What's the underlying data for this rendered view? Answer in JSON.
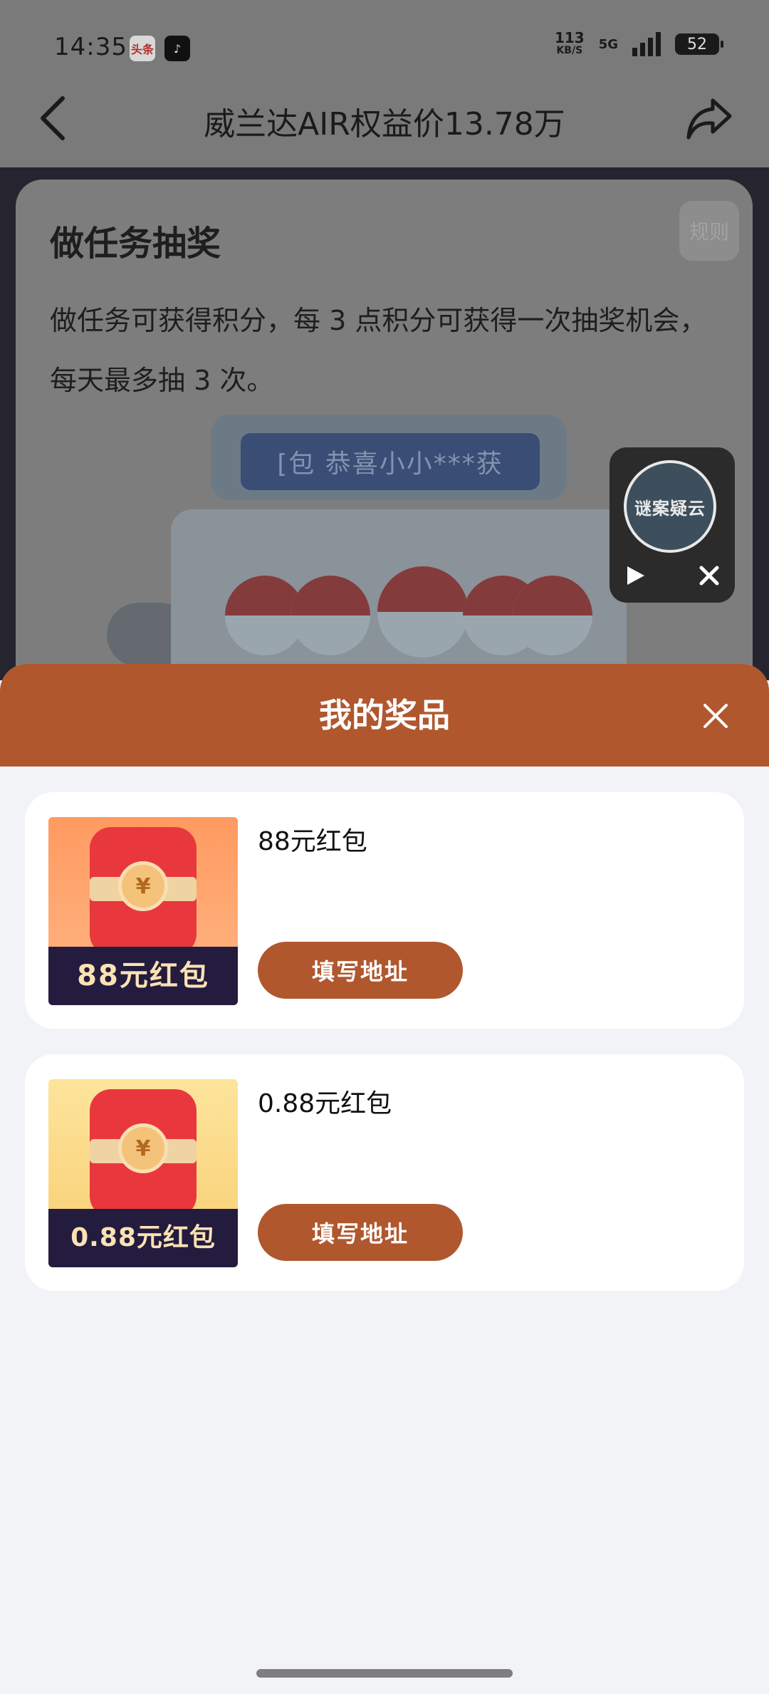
{
  "status_bar": {
    "time": "14:35",
    "apps": [
      {
        "name": "toutiao",
        "glyph": "头条"
      },
      {
        "name": "tiktok",
        "glyph": "♪"
      }
    ],
    "net_speed_value": "113",
    "net_speed_unit": "KB/S",
    "network": "5G",
    "battery": "52"
  },
  "header": {
    "title": "威兰达AIR权益价13.78万",
    "back_icon": "chevron-left-icon",
    "share_icon": "share-icon"
  },
  "task": {
    "title": "做任务抽奖",
    "rules_label": "规则",
    "description": "做任务可获得积分，每 3 点积分可获得一次抽奖机会，每天最多抽 3 次。",
    "marquee": "[包  恭喜小小***获"
  },
  "mini_player": {
    "cover_text": "谜案疑云",
    "play_icon": "play-icon",
    "close_icon": "close-icon"
  },
  "prizes_sheet": {
    "title": "我的奖品",
    "close_icon": "close-icon",
    "items": [
      {
        "name": "88元红包",
        "thumb_label": "88元红包",
        "button_label": "填写地址",
        "thumb_color_top": "#ff9e63",
        "thumb_color_bottom": "#ffb07c"
      },
      {
        "name": "0.88元红包",
        "thumb_label": "0.88元红包",
        "button_label": "填写地址",
        "thumb_color_top": "#fde39a",
        "thumb_color_bottom": "#f9cf73"
      }
    ]
  },
  "colors": {
    "accent": "#b0572e",
    "sheet_bg": "#f2f3f7",
    "card_bg": "#ffffff"
  }
}
